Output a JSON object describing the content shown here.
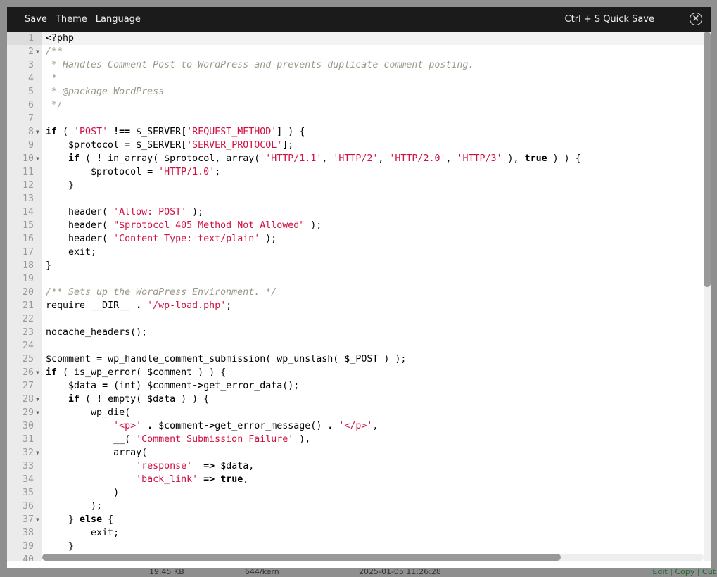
{
  "toolbar": {
    "menu": [
      "Save",
      "Theme",
      "Language"
    ],
    "hint": "Ctrl + S Quick Save",
    "close_icon": "close-circle-icon"
  },
  "statusbar": {
    "size": "19.45 KB",
    "perms": "644/kern",
    "modified": "2025-01-05 11:26:28",
    "actions": "Edit | Copy | Cut"
  },
  "colors": {
    "keyword": "#000000",
    "string": "#d01040",
    "comment": "#999988",
    "header": "#1b1b1b"
  },
  "editor": {
    "active_line": 1,
    "fold_lines": [
      2,
      8,
      10,
      26,
      28,
      29,
      32,
      37
    ],
    "lines": [
      [
        [
          "n",
          "<?php"
        ]
      ],
      [
        [
          "c",
          "/**"
        ]
      ],
      [
        [
          "c",
          " * Handles Comment Post to WordPress and prevents duplicate comment posting."
        ]
      ],
      [
        [
          "c",
          " *"
        ]
      ],
      [
        [
          "c",
          " * @package WordPress"
        ]
      ],
      [
        [
          "c",
          " */"
        ]
      ],
      [],
      [
        [
          "k",
          "if"
        ],
        [
          "n",
          " ( "
        ],
        [
          "s",
          "'POST'"
        ],
        [
          "n",
          " "
        ],
        [
          "o",
          "!=="
        ],
        [
          "n",
          " $_SERVER["
        ],
        [
          "s",
          "'REQUEST_METHOD'"
        ],
        [
          "n",
          "] ) {"
        ]
      ],
      [
        [
          "n",
          "    $protocol "
        ],
        [
          "o",
          "="
        ],
        [
          "n",
          " $_SERVER["
        ],
        [
          "s",
          "'SERVER_PROTOCOL'"
        ],
        [
          "n",
          "];"
        ]
      ],
      [
        [
          "n",
          "    "
        ],
        [
          "k",
          "if"
        ],
        [
          "n",
          " ( "
        ],
        [
          "o",
          "!"
        ],
        [
          "n",
          " in_array( $protocol, array( "
        ],
        [
          "s",
          "'HTTP/1.1'"
        ],
        [
          "n",
          ", "
        ],
        [
          "s",
          "'HTTP/2'"
        ],
        [
          "n",
          ", "
        ],
        [
          "s",
          "'HTTP/2.0'"
        ],
        [
          "n",
          ", "
        ],
        [
          "s",
          "'HTTP/3'"
        ],
        [
          "n",
          " ), "
        ],
        [
          "k",
          "true"
        ],
        [
          "n",
          " ) ) {"
        ]
      ],
      [
        [
          "n",
          "        $protocol "
        ],
        [
          "o",
          "="
        ],
        [
          "n",
          " "
        ],
        [
          "s",
          "'HTTP/1.0'"
        ],
        [
          "n",
          ";"
        ]
      ],
      [
        [
          "n",
          "    }"
        ]
      ],
      [],
      [
        [
          "n",
          "    header( "
        ],
        [
          "s",
          "'Allow: POST'"
        ],
        [
          "n",
          " );"
        ]
      ],
      [
        [
          "n",
          "    header( "
        ],
        [
          "s",
          "\"$protocol 405 Method Not Allowed\""
        ],
        [
          "n",
          " );"
        ]
      ],
      [
        [
          "n",
          "    header( "
        ],
        [
          "s",
          "'Content-Type: text/plain'"
        ],
        [
          "n",
          " );"
        ]
      ],
      [
        [
          "n",
          "    exit;"
        ]
      ],
      [
        [
          "n",
          "}"
        ]
      ],
      [],
      [
        [
          "c",
          "/** Sets up the WordPress Environment. */"
        ]
      ],
      [
        [
          "n",
          "require __DIR__ "
        ],
        [
          "o",
          "."
        ],
        [
          "n",
          " "
        ],
        [
          "s",
          "'/wp-load.php'"
        ],
        [
          "n",
          ";"
        ]
      ],
      [],
      [
        [
          "n",
          "nocache_headers();"
        ]
      ],
      [],
      [
        [
          "n",
          "$comment "
        ],
        [
          "o",
          "="
        ],
        [
          "n",
          " wp_handle_comment_submission( wp_unslash( $_POST ) );"
        ]
      ],
      [
        [
          "k",
          "if"
        ],
        [
          "n",
          " ( is_wp_error( $comment ) ) {"
        ]
      ],
      [
        [
          "n",
          "    $data "
        ],
        [
          "o",
          "="
        ],
        [
          "n",
          " (int) $comment"
        ],
        [
          "o",
          "->"
        ],
        [
          "n",
          "get_error_data();"
        ]
      ],
      [
        [
          "n",
          "    "
        ],
        [
          "k",
          "if"
        ],
        [
          "n",
          " ( "
        ],
        [
          "o",
          "!"
        ],
        [
          "n",
          " empty( $data ) ) {"
        ]
      ],
      [
        [
          "n",
          "        wp_die("
        ]
      ],
      [
        [
          "n",
          "            "
        ],
        [
          "s",
          "'<p>'"
        ],
        [
          "n",
          " "
        ],
        [
          "o",
          "."
        ],
        [
          "n",
          " $comment"
        ],
        [
          "o",
          "->"
        ],
        [
          "n",
          "get_error_message() "
        ],
        [
          "o",
          "."
        ],
        [
          "n",
          " "
        ],
        [
          "s",
          "'</p>'"
        ],
        [
          "n",
          ","
        ]
      ],
      [
        [
          "n",
          "            __( "
        ],
        [
          "s",
          "'Comment Submission Failure'"
        ],
        [
          "n",
          " ),"
        ]
      ],
      [
        [
          "n",
          "            array("
        ]
      ],
      [
        [
          "n",
          "                "
        ],
        [
          "s",
          "'response'"
        ],
        [
          "n",
          "  "
        ],
        [
          "o",
          "=>"
        ],
        [
          "n",
          " $data,"
        ]
      ],
      [
        [
          "n",
          "                "
        ],
        [
          "s",
          "'back_link'"
        ],
        [
          "n",
          " "
        ],
        [
          "o",
          "=>"
        ],
        [
          "n",
          " "
        ],
        [
          "k",
          "true"
        ],
        [
          "n",
          ","
        ]
      ],
      [
        [
          "n",
          "            )"
        ]
      ],
      [
        [
          "n",
          "        );"
        ]
      ],
      [
        [
          "n",
          "    } "
        ],
        [
          "k",
          "else"
        ],
        [
          "n",
          " {"
        ]
      ],
      [
        [
          "n",
          "        exit;"
        ]
      ],
      [
        [
          "n",
          "    }"
        ]
      ],
      [
        [
          "n",
          "}"
        ]
      ]
    ]
  }
}
